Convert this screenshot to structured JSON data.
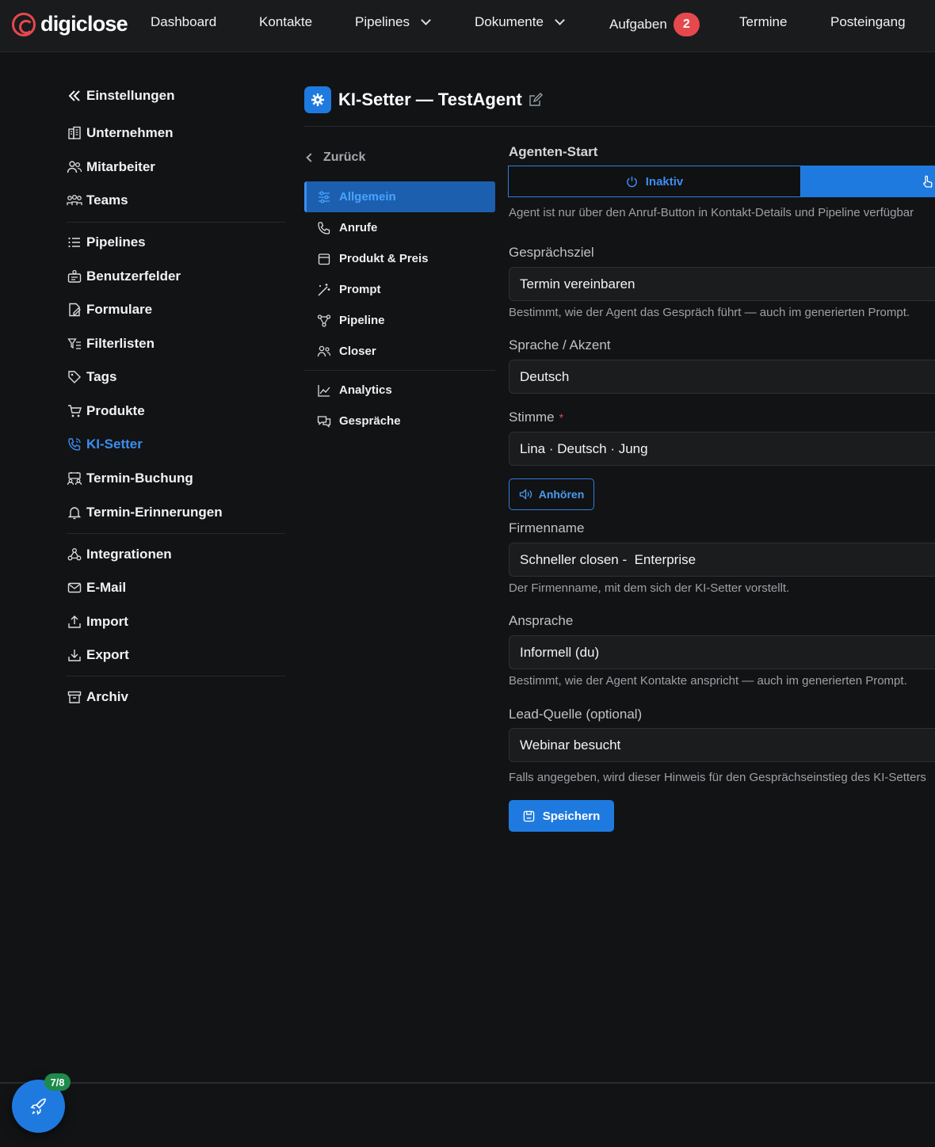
{
  "app": {
    "logo_text": "digiclose",
    "accent_color": "#1f7ae0",
    "danger_color": "#e5484d"
  },
  "topnav": {
    "items": [
      {
        "label": "Dashboard"
      },
      {
        "label": "Kontakte"
      },
      {
        "label": "Pipelines"
      },
      {
        "label": "Dokumente"
      },
      {
        "label": "Aufgaben",
        "badge": "2"
      },
      {
        "label": "Termine"
      },
      {
        "label": "Posteingang"
      }
    ]
  },
  "settings_nav": {
    "back_label": "Einstellungen",
    "items": [
      {
        "label": "Unternehmen",
        "icon": "building-icon"
      },
      {
        "label": "Mitarbeiter",
        "icon": "users-icon"
      },
      {
        "label": "Teams",
        "icon": "teams-icon"
      },
      {
        "label": "Pipelines",
        "icon": "list-icon"
      },
      {
        "label": "Benutzerfelder",
        "icon": "user-fields-icon"
      },
      {
        "label": "Formulare",
        "icon": "form-icon"
      },
      {
        "label": "Filterlisten",
        "icon": "filter-icon"
      },
      {
        "label": "Tags",
        "icon": "tag-icon"
      },
      {
        "label": "Produkte",
        "icon": "cart-icon"
      },
      {
        "label": "KI-Setter",
        "icon": "phone-icon",
        "active": true
      },
      {
        "label": "Termin-Buchung",
        "icon": "calendar-users-icon"
      },
      {
        "label": "Termin-Erinnerungen",
        "icon": "bell-icon"
      },
      {
        "label": "Integrationen",
        "icon": "webhook-icon"
      },
      {
        "label": "E-Mail",
        "icon": "mail-icon"
      },
      {
        "label": "Import",
        "icon": "upload-icon"
      },
      {
        "label": "Export",
        "icon": "download-icon"
      },
      {
        "label": "Archiv",
        "icon": "archive-icon"
      }
    ]
  },
  "header": {
    "title": "KI-Setter — TestAgent"
  },
  "subnav": {
    "back_label": "Zurück",
    "items": [
      {
        "label": "Allgemein",
        "active": true
      },
      {
        "label": "Anrufe"
      },
      {
        "label": "Produkt & Preis"
      },
      {
        "label": "Prompt"
      },
      {
        "label": "Pipeline"
      },
      {
        "label": "Closer"
      },
      {
        "label": "Analytics"
      },
      {
        "label": "Gespräche"
      }
    ]
  },
  "form": {
    "agent_start": {
      "label": "Agenten-Start",
      "inactive_label": "Inaktiv",
      "hint": "Agent ist nur über den Anruf-Button in Kontakt-Details und Pipeline verfügbar"
    },
    "goal": {
      "label": "Gesprächsziel",
      "value": "Termin vereinbaren",
      "hint": "Bestimmt, wie der Agent das Gespräch führt — auch im generierten Prompt."
    },
    "language": {
      "label": "Sprache / Akzent",
      "value": "Deutsch"
    },
    "voice": {
      "label": "Stimme",
      "required_mark": "*",
      "value": "Lina · Deutsch · Jung",
      "listen_label": "Anhören"
    },
    "company": {
      "label": "Firmenname",
      "value": "Schneller closen -  Enterprise",
      "hint": "Der Firmenname, mit dem sich der KI-Setter vorstellt."
    },
    "address": {
      "label": "Ansprache",
      "value": "Informell (du)",
      "hint": "Bestimmt, wie der Agent Kontakte anspricht — auch im generierten Prompt."
    },
    "lead_source": {
      "label": "Lead-Quelle (optional)",
      "value": "Webinar besucht",
      "hint": "Falls angegeben, wird dieser Hinweis für den Gesprächseinstieg des KI-Setters"
    },
    "save_label": "Speichern"
  },
  "onboarding": {
    "progress_label": "7/8"
  }
}
